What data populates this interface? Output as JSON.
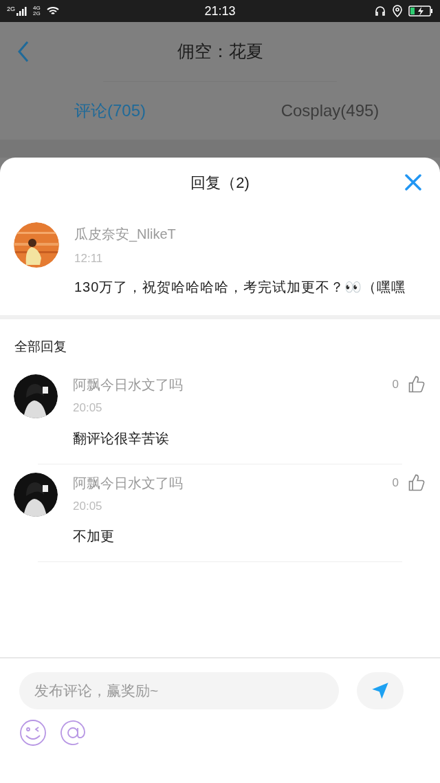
{
  "status_bar": {
    "time": "21:13",
    "network_1": "2G",
    "network_2": "4G",
    "network_3": "2G"
  },
  "header": {
    "title": "佣空：花夏"
  },
  "tabs": [
    {
      "label": "评论(705)",
      "selected": true
    },
    {
      "label": "Cosplay(495)",
      "selected": false
    }
  ],
  "sheet": {
    "title": "回复（2)"
  },
  "comment": {
    "author": "瓜皮奈安_NlikeT",
    "time": "12:11",
    "text": "130万了，祝贺哈哈哈哈，考完试加更不？👀（嘿嘿"
  },
  "replies_heading": "全部回复",
  "replies": [
    {
      "author": "阿飘今日水文了吗",
      "time": "20:05",
      "likes": "0",
      "liked": false,
      "text": "翻评论很辛苦诶"
    },
    {
      "author": "阿飘今日水文了吗",
      "time": "20:05",
      "likes": "0",
      "liked": false,
      "text": "不加更"
    }
  ],
  "composer": {
    "placeholder": "发布评论，赢奖励~"
  }
}
